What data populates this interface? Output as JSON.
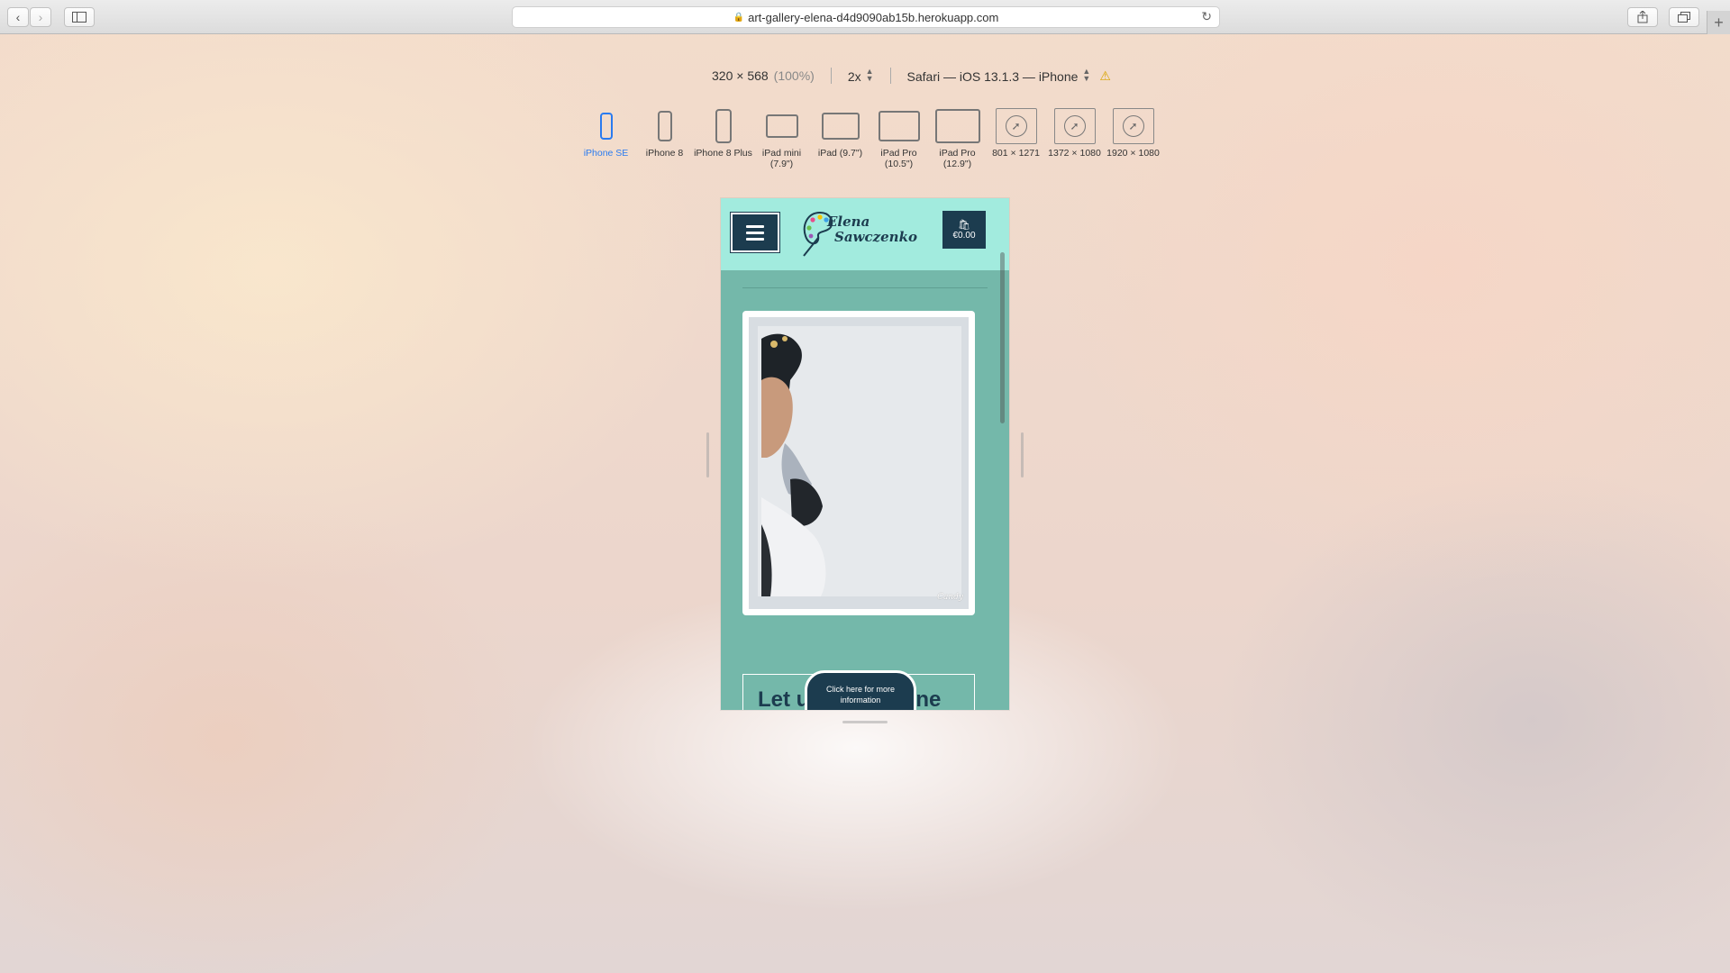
{
  "browser": {
    "url": "art-gallery-elena-d4d9090ab15b.herokuapp.com"
  },
  "rdm": {
    "dimensions": "320 × 568",
    "zoom": "(100%)",
    "pixel_ratio": "2x",
    "user_agent": "Safari — iOS 13.1.3 — iPhone",
    "devices": [
      {
        "label": "iPhone SE",
        "active": true
      },
      {
        "label": "iPhone 8",
        "active": false
      },
      {
        "label": "iPhone 8 Plus",
        "active": false
      },
      {
        "label": "iPad mini (7.9\")",
        "active": false
      },
      {
        "label": "iPad (9.7\")",
        "active": false
      },
      {
        "label": "iPad Pro (10.5\")",
        "active": false
      },
      {
        "label": "iPad Pro (12.9\")",
        "active": false
      },
      {
        "label": "801 × 1271",
        "active": false
      },
      {
        "label": "1372 × 1080",
        "active": false
      },
      {
        "label": "1920 × 1080",
        "active": false
      }
    ]
  },
  "site": {
    "logo_line1": "Elena",
    "logo_line2": "Sawczenko",
    "cart_total": "€0.00",
    "info_title": "Let u",
    "info_title_end": "ne",
    "info_button": "Click here for more information",
    "signature": "Candy"
  },
  "colors": {
    "header_bg": "#a2ebde",
    "page_bg": "#74b8aa",
    "navy": "#1c3c4f",
    "active_device": "#2a7bf0"
  }
}
